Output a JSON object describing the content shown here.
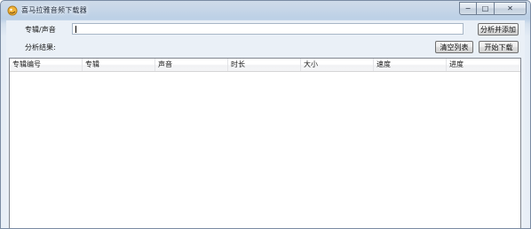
{
  "window": {
    "title": "喜马拉雅音频下载器",
    "controls": {
      "minimize": "−",
      "maximize": "□",
      "close": "✕"
    }
  },
  "form": {
    "album_sound_label": "专辑/声音",
    "album_sound_value": "",
    "analyze_add_label": "分析并添加",
    "result_label": "分析结果:",
    "clear_list_label": "清空列表",
    "start_download_label": "开始下载"
  },
  "list": {
    "columns": [
      "专辑编号",
      "专辑",
      "声音",
      "时长",
      "大小",
      "速度",
      "进度"
    ],
    "rows": []
  },
  "colors": {
    "title_gradient_top": "#cfdbe9",
    "client_bg": "#eaf0f7",
    "list_bg": "#ffffff",
    "border": "#828790"
  }
}
